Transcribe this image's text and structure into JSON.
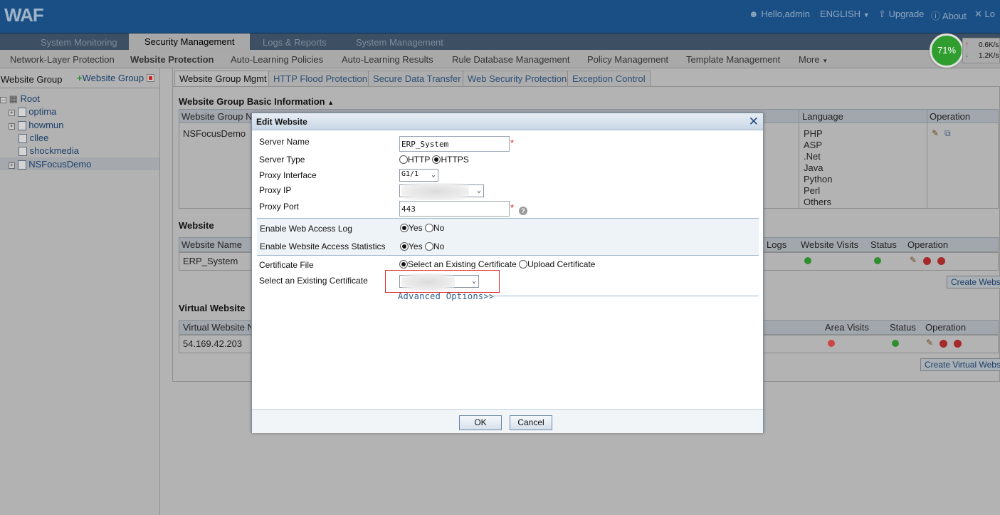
{
  "app": {
    "logo": "WAF"
  },
  "top_links": {
    "hello": "Hello,admin",
    "language": "ENGLISH",
    "upgrade": "Upgrade",
    "about": "About",
    "logout": "Lo"
  },
  "main_tabs": [
    "System Monitoring",
    "Security Management",
    "Logs & Reports",
    "System Management"
  ],
  "sub_tabs": [
    "Network-Layer Protection",
    "Website Protection",
    "Auto-Learning Policies",
    "Auto-Learning Results",
    "Rule Database Management",
    "Policy Management",
    "Template Management",
    "More"
  ],
  "status_widget": {
    "load": "71%",
    "up_speed": "0.6K/s",
    "down_speed": "1.2K/s"
  },
  "sidebar": {
    "title": "Website Group",
    "add_label": "Website Group",
    "tree": [
      "Root",
      "optima",
      "howmun",
      "cllee",
      "shockmedia",
      "NSFocusDemo"
    ]
  },
  "content_tabs": [
    "Website Group Mgmt",
    "HTTP Flood Protection",
    "Secure Data Transfer",
    "Web Security Protection",
    "Exception Control"
  ],
  "group_info": {
    "title": "Website Group Basic Information",
    "col_name": "Website Group Na",
    "col_language": "Language",
    "col_operation": "Operation",
    "row_name": "NSFocusDemo",
    "languages": [
      "PHP",
      "ASP",
      ".Net",
      "Java",
      "Python",
      "Perl",
      "Others"
    ]
  },
  "website_section": {
    "title": "Website",
    "col_name": "Website Name",
    "col_logs": "Logs",
    "col_visits": "Website Visits",
    "col_status": "Status",
    "col_operation": "Operation",
    "row_name": "ERP_System",
    "create_button": "Create Webs"
  },
  "virtual_section": {
    "title": "Virtual Website",
    "col_name": "Virtual Website Na",
    "col_area": "Area Visits",
    "col_status": "Status",
    "col_operation": "Operation",
    "row_name": "54.169.42.203",
    "create_button": "Create Virtual Webs"
  },
  "dialog": {
    "title": "Edit Website",
    "server_name_label": "Server Name",
    "server_name_value": "ERP_System",
    "server_type_label": "Server Type",
    "server_type_options": [
      "HTTP",
      "HTTPS"
    ],
    "server_type_selected": "HTTPS",
    "proxy_interface_label": "Proxy Interface",
    "proxy_interface_value": "G1/1",
    "proxy_ip_label": "Proxy IP",
    "proxy_port_label": "Proxy Port",
    "proxy_port_value": "443",
    "access_log_label": "Enable Web Access Log",
    "access_stats_label": "Enable Website Access Statistics",
    "yes": "Yes",
    "no": "No",
    "cert_file_label": "Certificate File",
    "cert_option_existing": "Select an Existing Certificate",
    "cert_option_upload": "Upload Certificate",
    "select_cert_label": "Select an Existing Certificate",
    "advanced_link": "Advanced Options>>",
    "required_mark": "*",
    "ok_button": "OK",
    "cancel_button": "Cancel"
  }
}
